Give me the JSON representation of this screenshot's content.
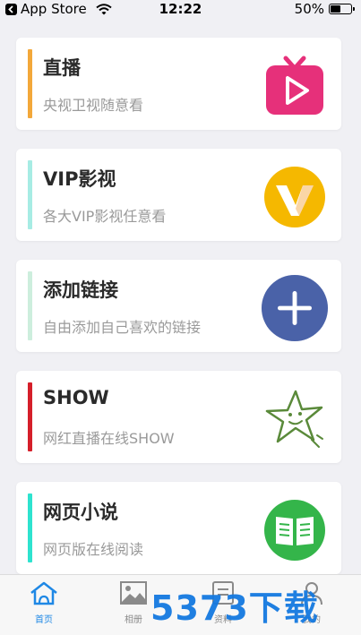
{
  "status_bar": {
    "carrier": "App Store",
    "time": "12:22",
    "battery": "50%",
    "battery_level": 0.5
  },
  "cards": [
    {
      "title": "直播",
      "subtitle": "央视卫视随意看",
      "bar_color": "#f3a83a",
      "icon": "tv-play-icon",
      "icon_color": "#e6307a"
    },
    {
      "title": "VIP影视",
      "subtitle": "各大VIP影视任意看",
      "bar_color": "#a7ece4",
      "icon": "vip-v-icon",
      "icon_color": "#f5b800"
    },
    {
      "title": "添加链接",
      "subtitle": "自由添加自己喜欢的链接",
      "bar_color": "#cdeedd",
      "icon": "plus-circle-icon",
      "icon_color": "#4a62a8"
    },
    {
      "title": "SHOW",
      "subtitle": "网红直播在线SHOW",
      "bar_color": "#d51f2a",
      "icon": "star-face-icon",
      "icon_color": "#5a8a3a"
    },
    {
      "title": "网页小说",
      "subtitle": "网页版在线阅读",
      "bar_color": "#2ee3cf",
      "icon": "book-icon",
      "icon_color": "#34b54a"
    }
  ],
  "tabbar": {
    "tabs": [
      {
        "label": "首页",
        "icon": "home-icon",
        "active": true
      },
      {
        "label": "相册",
        "icon": "photo-icon",
        "active": false
      },
      {
        "label": "资料",
        "icon": "profile-card-icon",
        "active": false
      },
      {
        "label": "我的",
        "icon": "user-icon",
        "active": false
      }
    ],
    "accent_color": "#1f88e5"
  },
  "watermark": "5373下载"
}
